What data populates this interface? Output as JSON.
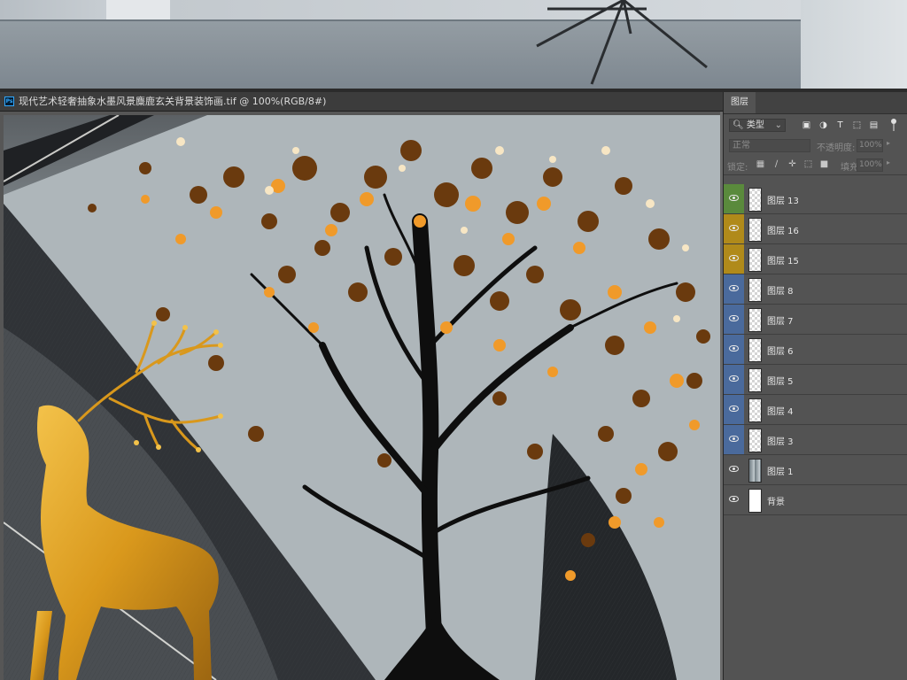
{
  "document": {
    "app_badge": "Ps",
    "tab_title": "现代艺术轻奢抽象水墨风景麋鹿玄关背景装饰画.tif @ 100%(RGB/8#)"
  },
  "layers_panel": {
    "tab_label": "图层",
    "filter": {
      "kind_label": "类型",
      "icons": [
        "image-filter-icon",
        "adjustment-filter-icon",
        "type-filter-icon",
        "shape-filter-icon",
        "smart-object-filter-icon"
      ]
    },
    "blend_mode": "正常",
    "opacity_label": "不透明度:",
    "opacity_value": "100%",
    "lock_label": "锁定:",
    "lock_icons": [
      "lock-transparent-icon",
      "lock-paint-icon",
      "lock-move-icon",
      "lock-artboard-icon",
      "lock-all-icon"
    ],
    "fill_label": "填充:",
    "fill_value": "100%",
    "layers": [
      {
        "name": "图层 13",
        "color": "#5a8a3c",
        "thumb": "checker"
      },
      {
        "name": "图层 16",
        "color": "#b08a1a",
        "thumb": "checker"
      },
      {
        "name": "图层 15",
        "color": "#b08a1a",
        "thumb": "checker"
      },
      {
        "name": "图层 8",
        "color": "#4a6a9c",
        "thumb": "checker"
      },
      {
        "name": "图层 7",
        "color": "#4a6a9c",
        "thumb": "checker"
      },
      {
        "name": "图层 6",
        "color": "#4a6a9c",
        "thumb": "checker"
      },
      {
        "name": "图层 5",
        "color": "#4a6a9c",
        "thumb": "checker"
      },
      {
        "name": "图层 4",
        "color": "#4a6a9c",
        "thumb": "checker"
      },
      {
        "name": "图层 3",
        "color": "#4a6a9c",
        "thumb": "checker"
      },
      {
        "name": "图层 1",
        "color": "#535353",
        "thumb": "gradient"
      },
      {
        "name": "背景",
        "color": "#535353",
        "thumb": "white"
      }
    ]
  }
}
